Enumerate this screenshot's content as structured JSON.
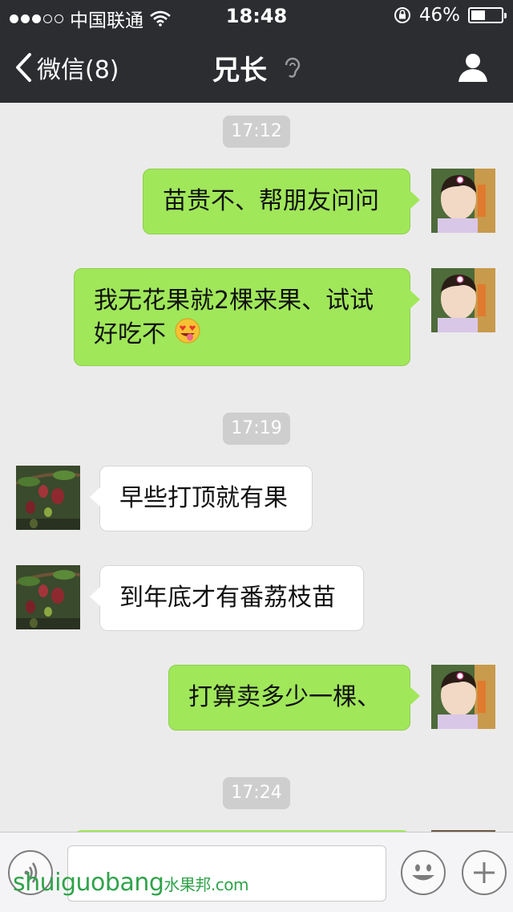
{
  "status_bar": {
    "signal_filled": 3,
    "signal_empty": 2,
    "carrier": "中国联通",
    "time": "18:48",
    "battery": "46%",
    "battery_level": 0.46
  },
  "nav": {
    "back_label": "微信(8)",
    "title": "兄长"
  },
  "colors": {
    "bar_bg": "#2b2d31",
    "chat_bg": "#ebebeb",
    "outgoing_bubble": "#a0e75a",
    "incoming_bubble": "#ffffff",
    "timestamp_bg": "#cecece"
  },
  "messages": [
    {
      "type": "time",
      "text": "17:12"
    },
    {
      "type": "out",
      "text": "苗贵不、帮朋友问问"
    },
    {
      "type": "out",
      "line1": "我无花果就2棵来果、试试",
      "line2": "好吃不",
      "emoji": "heart-eyes-tongue-emoji"
    },
    {
      "type": "time",
      "text": "17:19"
    },
    {
      "type": "in",
      "text": "早些打顶就有果"
    },
    {
      "type": "in",
      "text": "到年底才有番荔枝苗"
    },
    {
      "type": "out",
      "text": "打算卖多少一棵、"
    },
    {
      "type": "time",
      "text": "17:24"
    }
  ],
  "input_bar": {
    "voice_icon": "voice-icon",
    "emoji_icon": "smiley-icon",
    "plus_icon": "plus-icon"
  },
  "watermark": {
    "text": "shuiguobang",
    "cn": "水果邦",
    "suffix": ".com"
  }
}
